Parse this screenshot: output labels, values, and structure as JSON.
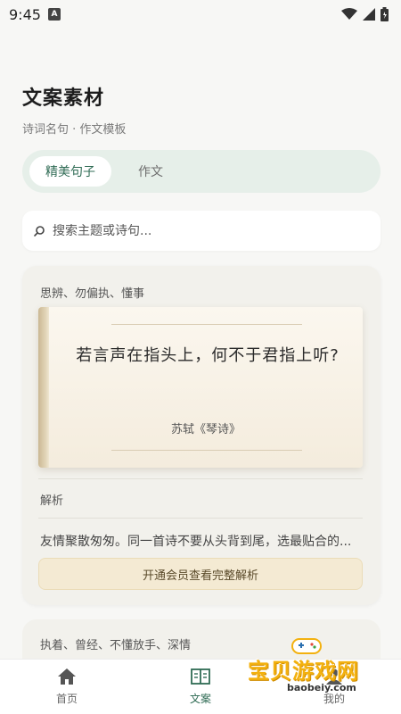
{
  "status_bar": {
    "time": "9:45",
    "notification_badge": "A"
  },
  "header": {
    "title": "文案素材",
    "subtitle": "诗词名句 · 作文模板"
  },
  "tabs": [
    {
      "label": "精美句子",
      "active": true
    },
    {
      "label": "作文",
      "active": false
    }
  ],
  "search": {
    "placeholder": "搜索主题或诗句..."
  },
  "cards": [
    {
      "tags": "思辨、勿偏执、懂事",
      "poem": "若言声在指头上，何不于君指上听?",
      "source": "苏轼《琴诗》",
      "analysis_label": "解析",
      "analysis_text": "友情聚散匆匆。同一首诗不要从头背到尾，选最贴合的...",
      "vip_button": "开通会员查看完整解析"
    },
    {
      "tags": "执着、曾经、不懂放手、深情"
    }
  ],
  "bottom_nav": [
    {
      "label": "首页",
      "icon": "home-icon",
      "active": false
    },
    {
      "label": "文案",
      "icon": "book-icon",
      "active": true
    },
    {
      "label": "我的",
      "icon": "profile-icon",
      "active": false
    }
  ],
  "watermark": {
    "text": "宝贝游戏网",
    "url": "baobeiy.com"
  },
  "colors": {
    "accent": "#2f6b54",
    "tab_bg": "#e6efe9",
    "vip_bg": "#f4ead3",
    "watermark": "#f3b10f"
  }
}
